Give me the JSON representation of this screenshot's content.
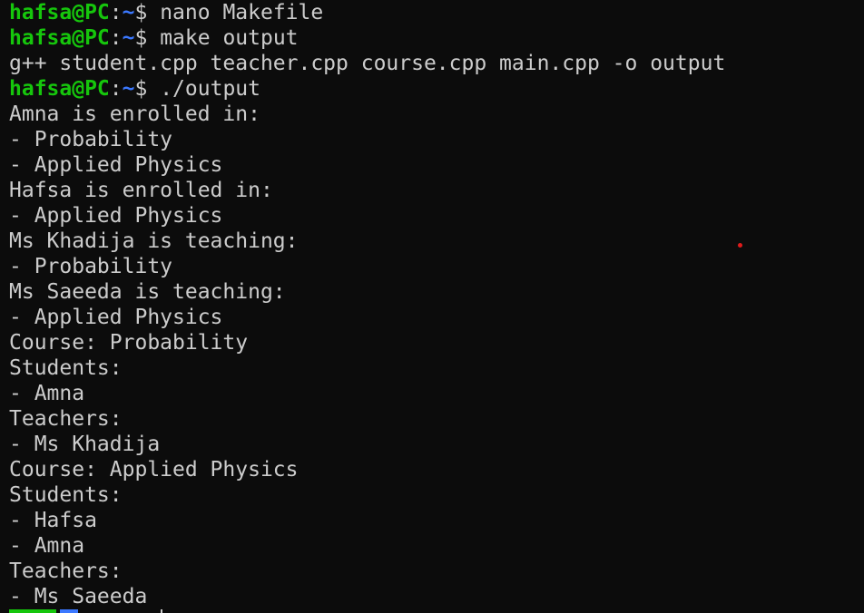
{
  "prompt": {
    "user_host": "hafsa@PC",
    "colon": ":",
    "path": "~",
    "dollar": "$"
  },
  "lines": [
    {
      "type": "prompt",
      "command": " nano Makefile"
    },
    {
      "type": "prompt",
      "command": " make output"
    },
    {
      "type": "output",
      "text": "g++ student.cpp teacher.cpp course.cpp main.cpp -o output"
    },
    {
      "type": "prompt",
      "command": " ./output"
    },
    {
      "type": "output",
      "text": "Amna is enrolled in:"
    },
    {
      "type": "output",
      "text": "- Probability"
    },
    {
      "type": "output",
      "text": "- Applied Physics"
    },
    {
      "type": "output",
      "text": "Hafsa is enrolled in:"
    },
    {
      "type": "output",
      "text": "- Applied Physics"
    },
    {
      "type": "output",
      "text": "Ms Khadija is teaching:"
    },
    {
      "type": "output",
      "text": "- Probability"
    },
    {
      "type": "output",
      "text": "Ms Saeeda is teaching:"
    },
    {
      "type": "output",
      "text": "- Applied Physics"
    },
    {
      "type": "output",
      "text": "Course: Probability"
    },
    {
      "type": "output",
      "text": "Students:"
    },
    {
      "type": "output",
      "text": "- Amna"
    },
    {
      "type": "output",
      "text": "Teachers:"
    },
    {
      "type": "output",
      "text": "- Ms Khadija"
    },
    {
      "type": "output",
      "text": "Course: Applied Physics"
    },
    {
      "type": "output",
      "text": "Students:"
    },
    {
      "type": "output",
      "text": "- Hafsa"
    },
    {
      "type": "output",
      "text": "- Amna"
    },
    {
      "type": "output",
      "text": "Teachers:"
    },
    {
      "type": "output",
      "text": "- Ms Saeeda"
    }
  ],
  "colors": {
    "background": "#0c0c0c",
    "foreground": "#cccccc",
    "user_host": "#16c60c",
    "path": "#3b78ff",
    "marker_dot": "#e01b1b"
  }
}
